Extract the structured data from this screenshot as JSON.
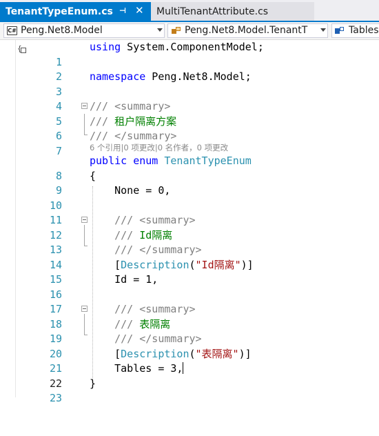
{
  "tabs": {
    "active": "TenantTypeEnum.cs",
    "pin_icon": "pin-icon",
    "close_icon": "close-icon",
    "inactive": "MultiTenantAttribute.cs"
  },
  "navbar": {
    "project": "Peng.Net8.Model",
    "project_badge": "C#",
    "type": "Peng.Net8.Model.TenantT",
    "member": "Tables"
  },
  "editor": {
    "line_numbers": [
      "1",
      "2",
      "3",
      "4",
      "5",
      "6",
      "7",
      "8",
      "9",
      "10",
      "11",
      "12",
      "13",
      "14",
      "15",
      "16",
      "17",
      "18",
      "19",
      "20",
      "21",
      "22",
      "23"
    ],
    "codelens": "6 个引用|0 项更改|0 名作者，0 项更改",
    "current_line": "22",
    "tokens": {
      "l1_kw": "using",
      "l1_rest": " System.ComponentModel;",
      "l3_kw": "namespace",
      "l3_rest": " Peng.Net8.Model;",
      "l5_slashes": "/// ",
      "l5_tag": "<summary>",
      "l6_slashes": "/// ",
      "l6_text": "租户隔离方案",
      "l7_slashes": "/// ",
      "l7_tag": "</summary>",
      "l8_kw": "public enum ",
      "l8_type": "TenantTypeEnum",
      "l9": "{",
      "l10": "    None = 0,",
      "l12_slashes": "    /// ",
      "l12_tag": "<summary>",
      "l13_slashes": "    /// ",
      "l13_text": "Id隔离",
      "l14_slashes": "    /// ",
      "l14_tag": "</summary>",
      "l15_open": "    [",
      "l15_type": "Description",
      "l15_paren": "(",
      "l15_str": "\"Id隔离\"",
      "l15_close": ")]",
      "l16": "    Id = 1,",
      "l18_slashes": "    /// ",
      "l18_tag": "<summary>",
      "l19_slashes": "    /// ",
      "l19_text": "表隔离",
      "l20_slashes": "    /// ",
      "l20_tag": "</summary>",
      "l21_open": "    [",
      "l21_type": "Description",
      "l21_paren": "(",
      "l21_str": "\"表隔离\"",
      "l21_close": ")]",
      "l22": "    Tables = 3,",
      "l23": "}"
    }
  },
  "colors": {
    "accent": "#007acc",
    "keyword": "#0000ff",
    "type": "#2b91af",
    "string": "#a31515",
    "comment": "#008000",
    "xml_doc_tag": "#808080"
  }
}
